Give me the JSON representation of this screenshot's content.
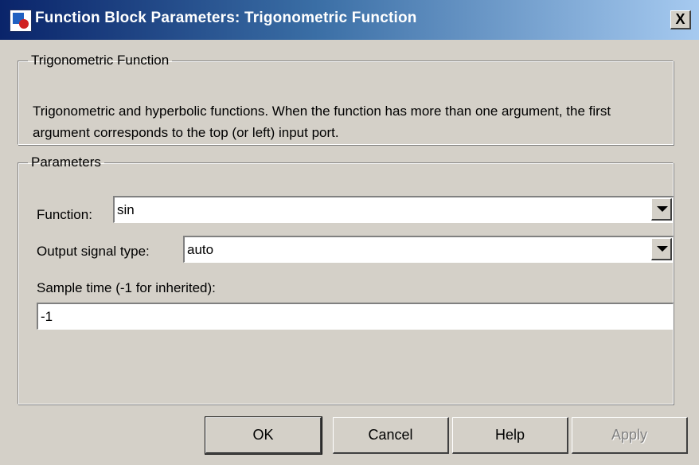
{
  "window": {
    "title": "Function Block Parameters: Trigonometric Function",
    "close_label": "X"
  },
  "block_group": {
    "legend": "Trigonometric Function",
    "description": "Trigonometric and hyperbolic functions. When the function has more than one argument, the first argument corresponds to the top (or left) input port."
  },
  "params_group": {
    "legend": "Parameters",
    "function": {
      "label": "Function:",
      "value": "sin"
    },
    "output_signal_type": {
      "label": "Output signal type:",
      "value": "auto"
    },
    "sample_time": {
      "label": "Sample time (-1 for inherited):",
      "value": "-1"
    }
  },
  "buttons": {
    "ok": "OK",
    "cancel": "Cancel",
    "help": "Help",
    "apply": "Apply"
  },
  "colors": {
    "titlebar_start": "#0a246a",
    "titlebar_end": "#a6caf0",
    "face": "#d4d0c8"
  }
}
